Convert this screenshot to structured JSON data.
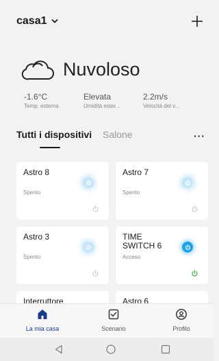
{
  "header": {
    "home_name": "casa1"
  },
  "weather": {
    "condition": "Nuvoloso",
    "metrics": [
      {
        "value": "-1.6°C",
        "label": "Temp. esterna"
      },
      {
        "value": "Elevata",
        "label": "Umidità ester..."
      },
      {
        "value": "2.2m/s",
        "label": "Velocità del v..."
      }
    ]
  },
  "tabs": {
    "active": "Tutti i dispositivi",
    "other": "Salone"
  },
  "devices": [
    {
      "name": "Astro 8",
      "status": "Spento"
    },
    {
      "name": "Astro 7",
      "status": "Spento"
    },
    {
      "name": "Astro 3",
      "status": "Spento"
    },
    {
      "name": "TIME SWITCH 6",
      "status": "Acceso"
    },
    {
      "name": "Interruttore",
      "status": ""
    },
    {
      "name": "Astro 6",
      "status": ""
    }
  ],
  "nav": {
    "home": "La mia casa",
    "scenes": "Scenario",
    "profile": "Profilo"
  },
  "colors": {
    "accent": "#1aa3e8",
    "on_green": "#4caf50",
    "nav_active": "#1a3a8a"
  }
}
